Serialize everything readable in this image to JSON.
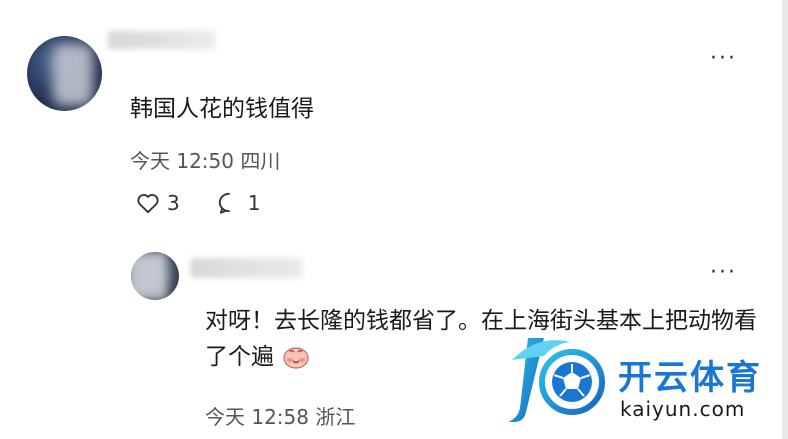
{
  "comments": [
    {
      "text": "韩国人花的钱值得",
      "meta": "今天 12:50 四川",
      "likes": "3",
      "replies": "1",
      "more_icon": "more-horizontal-icon"
    },
    {
      "text": "对呀！去长隆的钱都省了。在上海街头基本上把动物看了个遍",
      "emoji_icon": "blushing-face-emoji",
      "meta": "今天 12:58 浙江",
      "more_icon": "more-horizontal-icon"
    }
  ],
  "watermark": {
    "brand": "开云体育",
    "url": "kaiyun.com",
    "logo_icon": "kaiyun-k-soccer-logo"
  },
  "colors": {
    "brand_blue": "#1976d2",
    "brand_cyan": "#2ec4e6"
  }
}
